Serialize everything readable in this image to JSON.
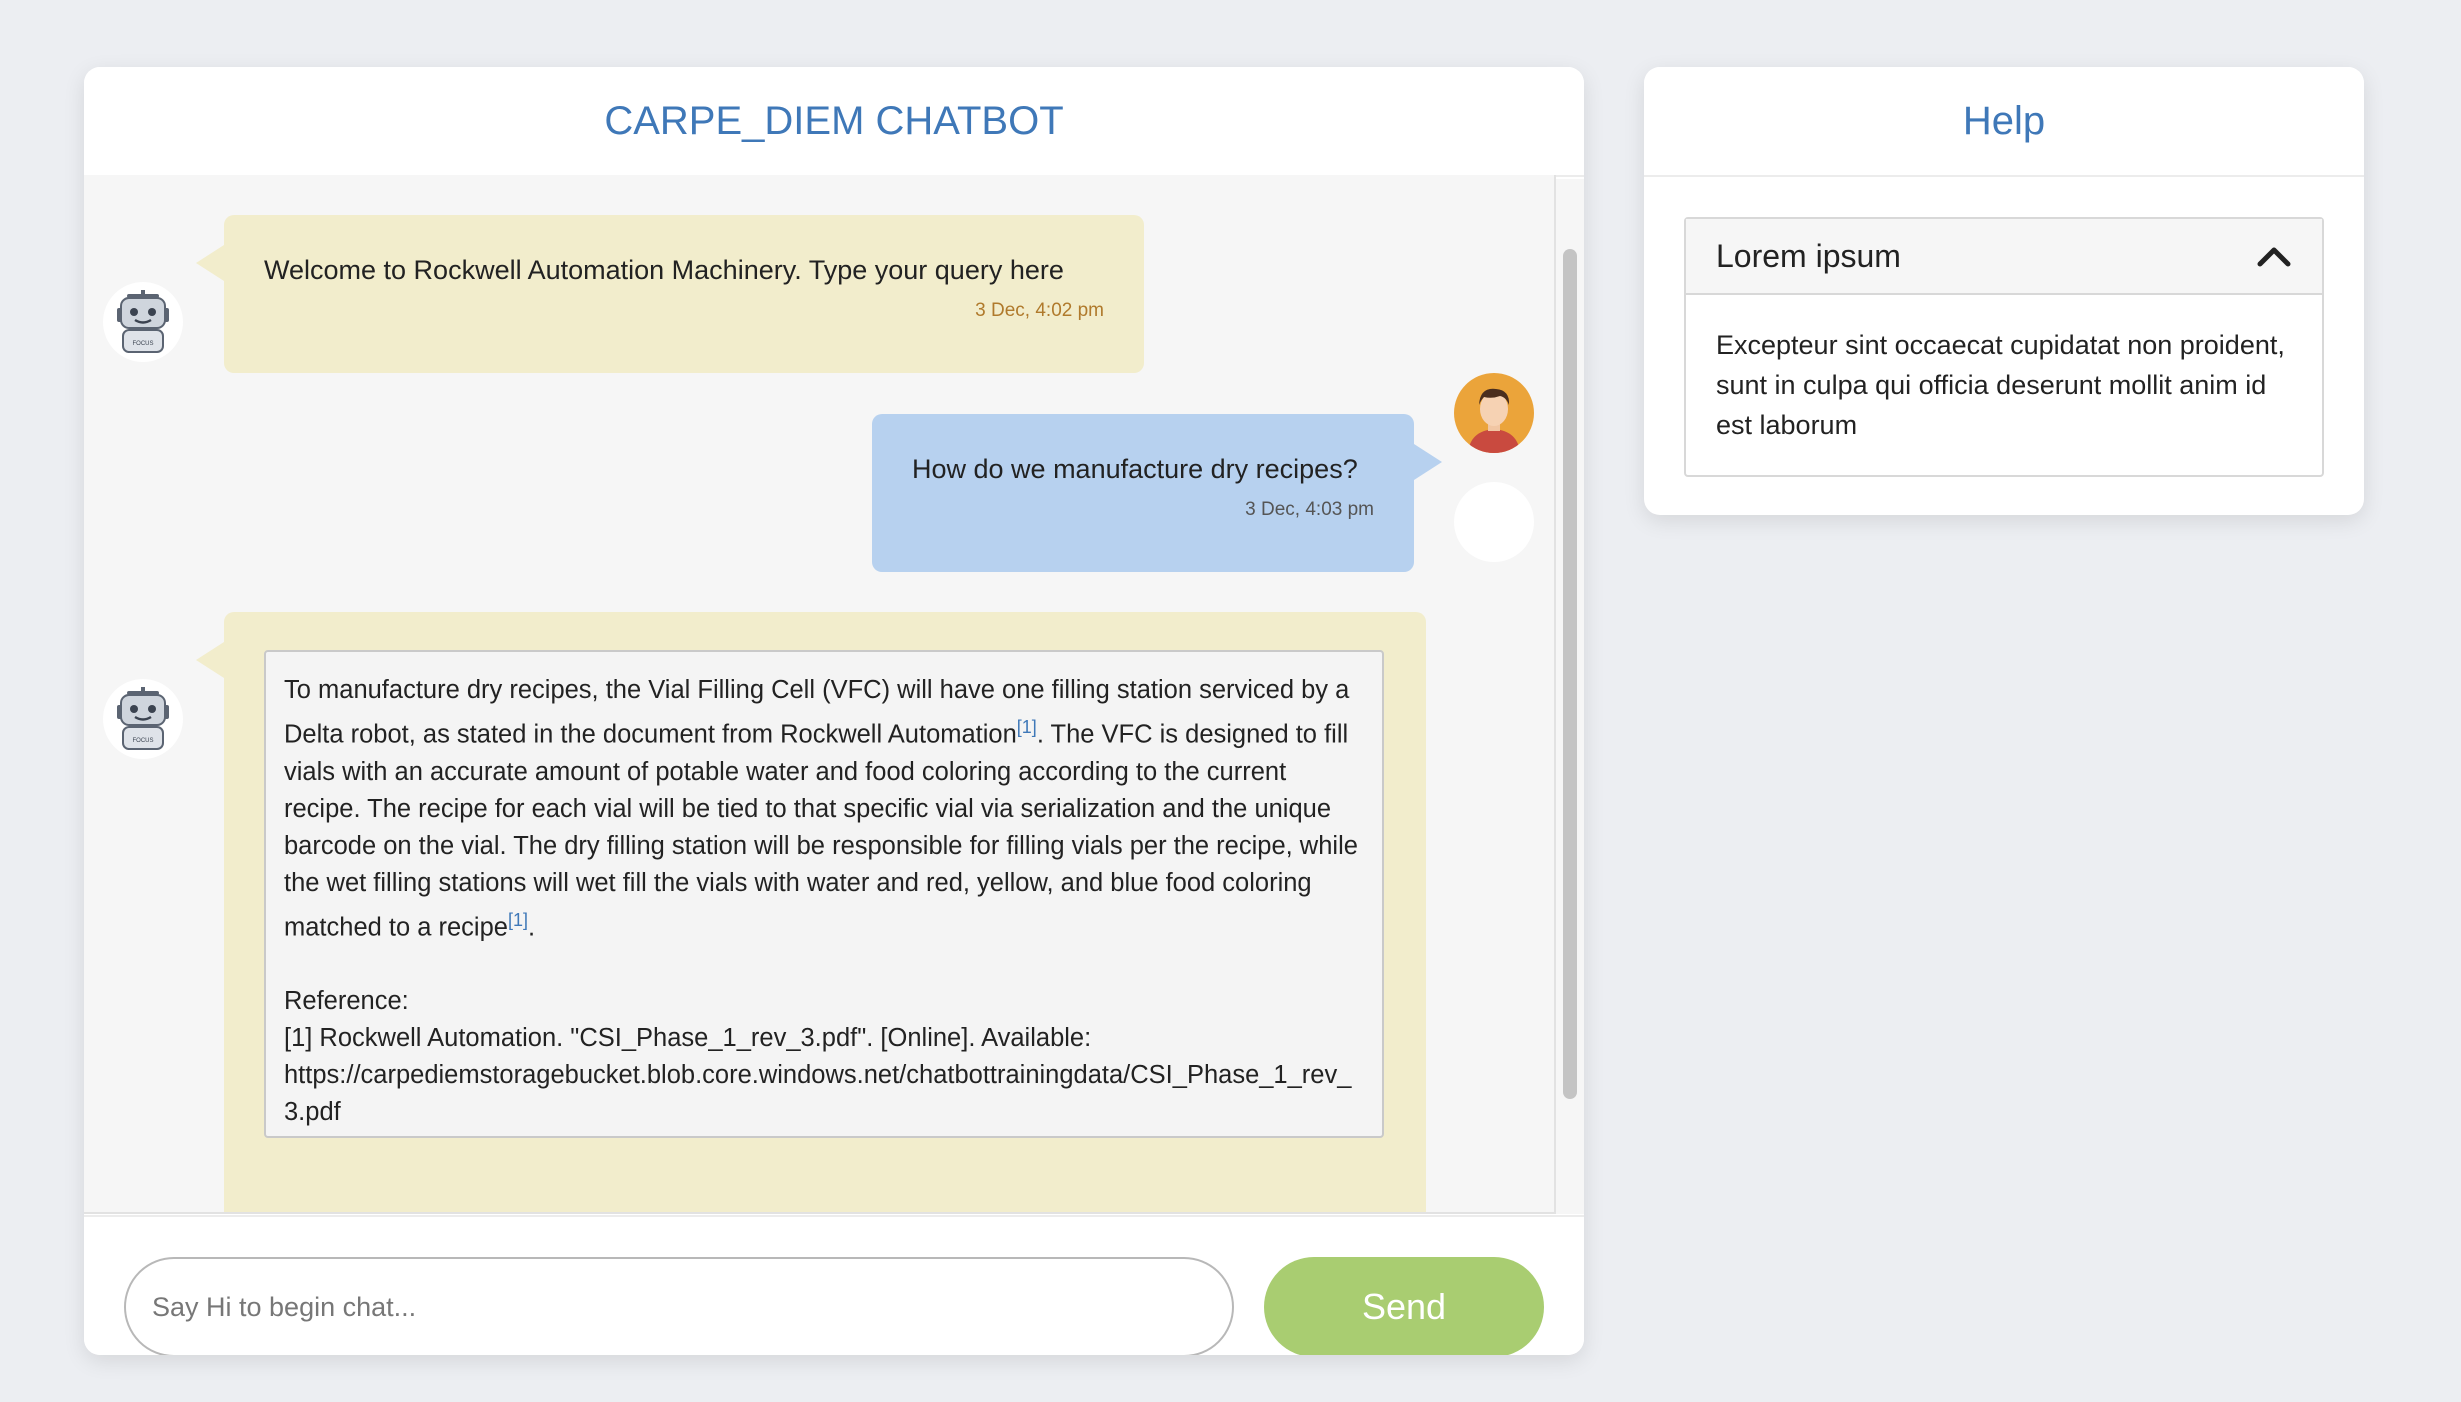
{
  "chat": {
    "title": "CARPE_DIEM CHATBOT",
    "messages": [
      {
        "sender": "bot",
        "text": "Welcome to Rockwell Automation Machinery. Type your query here",
        "time": "3 Dec, 4:02 pm"
      },
      {
        "sender": "user",
        "text": "How do we manufacture dry recipes?",
        "time": "3 Dec, 4:03 pm"
      }
    ],
    "answer": {
      "part1": "To manufacture dry recipes, the Vial Filling Cell (VFC) will have one filling station serviced by a Delta robot, as stated in the document from Rockwell Automation",
      "ref1": "[1]",
      "part2": ". The VFC is designed to fill vials with an accurate amount of potable water and food coloring according to the current recipe. The recipe for each vial will be tied to that specific vial via serialization and the unique barcode on the vial. The dry filling station will be responsible for filling vials per the recipe, while the wet filling stations will wet fill the vials with water and red, yellow, and blue food coloring matched to a recipe",
      "ref2": "[1]",
      "part3": ".",
      "reference_heading": "Reference:",
      "reference_line": "[1] Rockwell Automation. \"CSI_Phase_1_rev_3.pdf\". [Online]. Available:",
      "reference_url": "https://carpediemstoragebucket.blob.core.windows.net/chatbottrainingdata/CSI_Phase_1_rev_3.pdf"
    },
    "input_placeholder": "Say Hi to begin chat...",
    "send_label": "Send",
    "avatar_label": "FOCUS"
  },
  "help": {
    "title": "Help",
    "accordion": {
      "heading": "Lorem ipsum",
      "body": "Excepteur sint occaecat cupidatat non proident, sunt in culpa qui officia deserunt mollit anim id est laborum"
    }
  },
  "colors": {
    "accent": "#3f78b8",
    "bot_bubble": "#f2edcc",
    "user_bubble": "#b7d1ef",
    "send_button": "#a9cd71",
    "background": "#eceef2"
  }
}
